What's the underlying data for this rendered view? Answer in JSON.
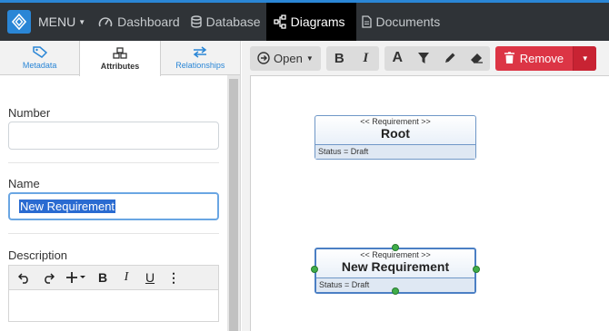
{
  "topbar": {
    "menu_label": "MENU",
    "nav": [
      {
        "label": "Dashboard",
        "icon": "dashboard-icon"
      },
      {
        "label": "Database",
        "icon": "database-icon"
      },
      {
        "label": "Diagrams",
        "icon": "diagram-icon",
        "active": true
      },
      {
        "label": "Documents",
        "icon": "document-icon"
      }
    ],
    "accent_color": "#2a86d6"
  },
  "sidebar": {
    "tabs": [
      {
        "label": "Metadata",
        "icon": "tag-icon"
      },
      {
        "label": "Attributes",
        "icon": "cubes-icon",
        "active": true
      },
      {
        "label": "Relationships",
        "icon": "exchange-icon"
      }
    ],
    "number": {
      "label": "Number",
      "value": ""
    },
    "name": {
      "label": "Name",
      "value": "New Requirement"
    },
    "description": {
      "label": "Description",
      "value": ""
    }
  },
  "toolbar": {
    "open_label": "Open",
    "remove_label": "Remove",
    "remove_color": "#dc3545"
  },
  "diagram": {
    "blocks": [
      {
        "stereotype": "<< Requirement >>",
        "name": "Root",
        "status": "Status = Draft"
      },
      {
        "stereotype": "<< Requirement >>",
        "name": "New Requirement",
        "status": "Status = Draft",
        "selected": true
      }
    ]
  }
}
